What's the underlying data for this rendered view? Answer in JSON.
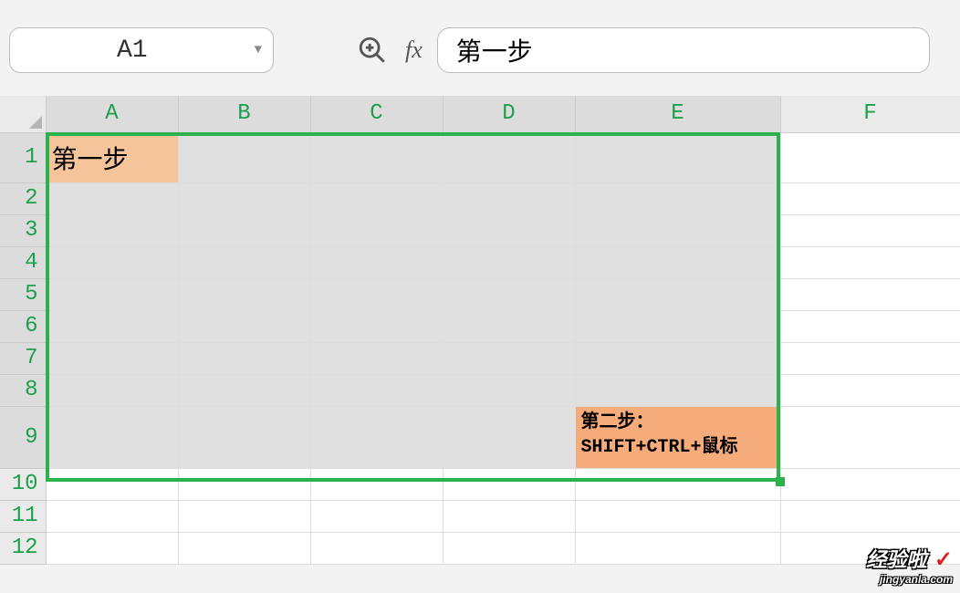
{
  "nameBox": {
    "value": "A1"
  },
  "formulaBar": {
    "fxLabel": "fx",
    "value": "第一步"
  },
  "columns": [
    "A",
    "B",
    "C",
    "D",
    "E",
    "F"
  ],
  "rows": [
    "1",
    "2",
    "3",
    "4",
    "5",
    "6",
    "7",
    "8",
    "9",
    "10",
    "11",
    "12"
  ],
  "selectedCols": [
    "A",
    "B",
    "C",
    "D",
    "E"
  ],
  "selectedRows": [
    "1",
    "2",
    "3",
    "4",
    "5",
    "6",
    "7",
    "8",
    "9"
  ],
  "cells": {
    "A1": "第一步",
    "E9_line1": "第二步：",
    "E9_line2": "SHIFT+CTRL+鼠标"
  },
  "watermark": {
    "title": "经验啦",
    "check": "✓",
    "url": "jingyanla.com"
  }
}
